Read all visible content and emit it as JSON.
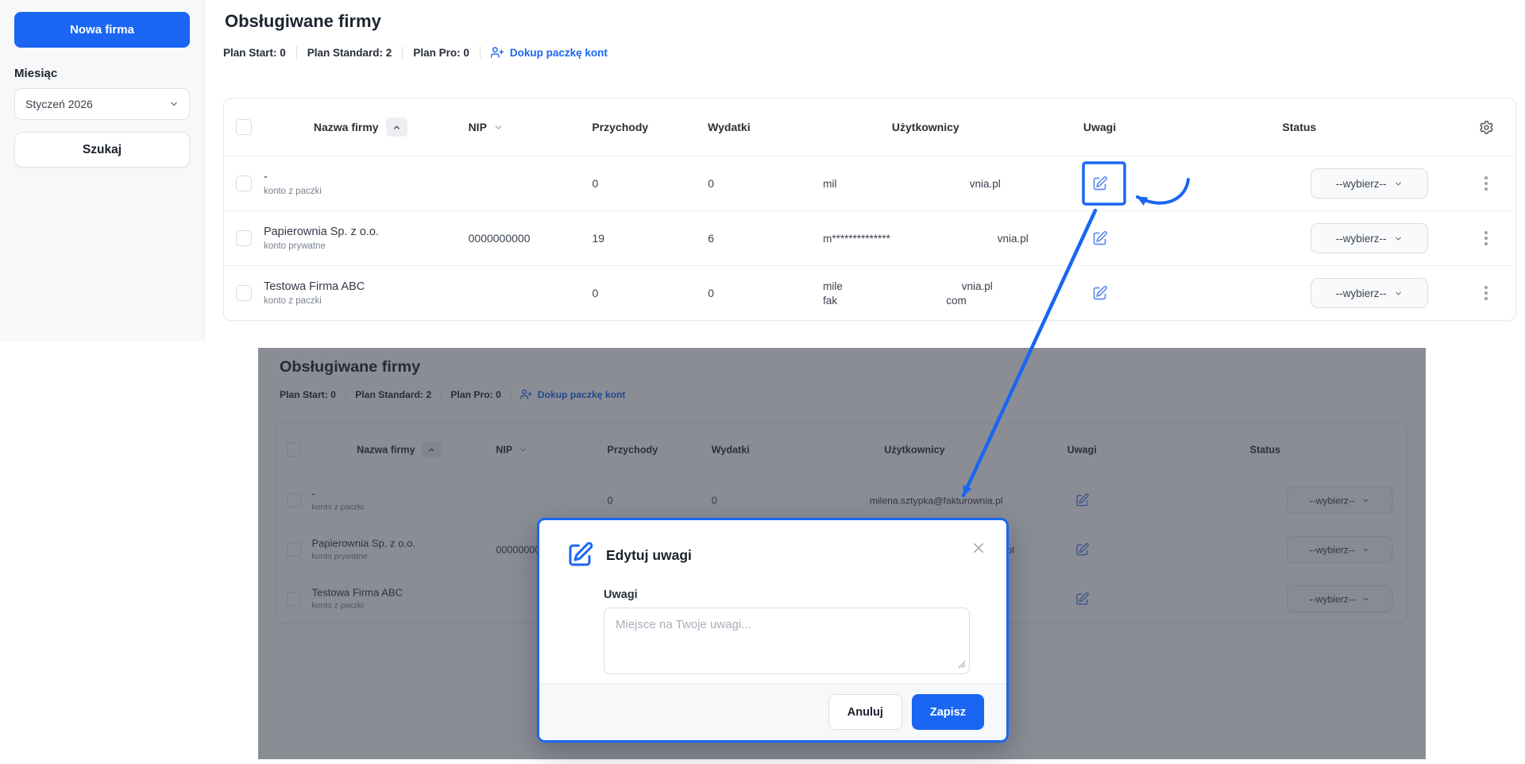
{
  "colors": {
    "primary": "#1a66f2",
    "edit_icon": "#5d8bf2",
    "dim_overlay": "rgba(42,48,60,0.55)"
  },
  "sidebar": {
    "new_company_button": "Nowa firma",
    "month_label": "Miesiąc",
    "month_value": "Styczeń 2026",
    "search_button": "Szukaj"
  },
  "header": {
    "title": "Obsługiwane firmy",
    "plan_start": "Plan Start: 0",
    "plan_standard": "Plan Standard: 2",
    "plan_pro": "Plan Pro: 0",
    "buy_pack_link": "Dokup paczkę kont"
  },
  "table": {
    "headers": {
      "name": "Nazwa firmy",
      "nip": "NIP",
      "revenue": "Przychody",
      "expenses": "Wydatki",
      "users": "Użytkownicy",
      "notes": "Uwagi",
      "status": "Status"
    },
    "rows": [
      {
        "name": "-",
        "type": "konto z paczki",
        "nip": "",
        "revenue": "0",
        "expenses": "0",
        "user_left": "mil",
        "user_right": "vnia.pl",
        "status": "--wybierz--"
      },
      {
        "name": "Papierownia Sp. z o.o.",
        "type": "konto prywatne",
        "nip": "0000000000",
        "revenue": "19",
        "expenses": "6",
        "user_left": "m**************",
        "user_right": "vnia.pl",
        "status": "--wybierz--"
      },
      {
        "name": "Testowa Firma ABC",
        "type": "konto z paczki",
        "nip": "",
        "revenue": "0",
        "expenses": "0",
        "user_left": "mile",
        "user_right": "vnia.pl",
        "user2_left": "fak",
        "user2_right": "com",
        "status": "--wybierz--"
      }
    ]
  },
  "screenshot": {
    "full_email": "milena.sztypka@fakturownia.pl"
  },
  "modal": {
    "title": "Edytuj uwagi",
    "notes_label": "Uwagi",
    "placeholder": "Miejsce na Twoje uwagi...",
    "cancel_button": "Anuluj",
    "save_button": "Zapisz"
  }
}
